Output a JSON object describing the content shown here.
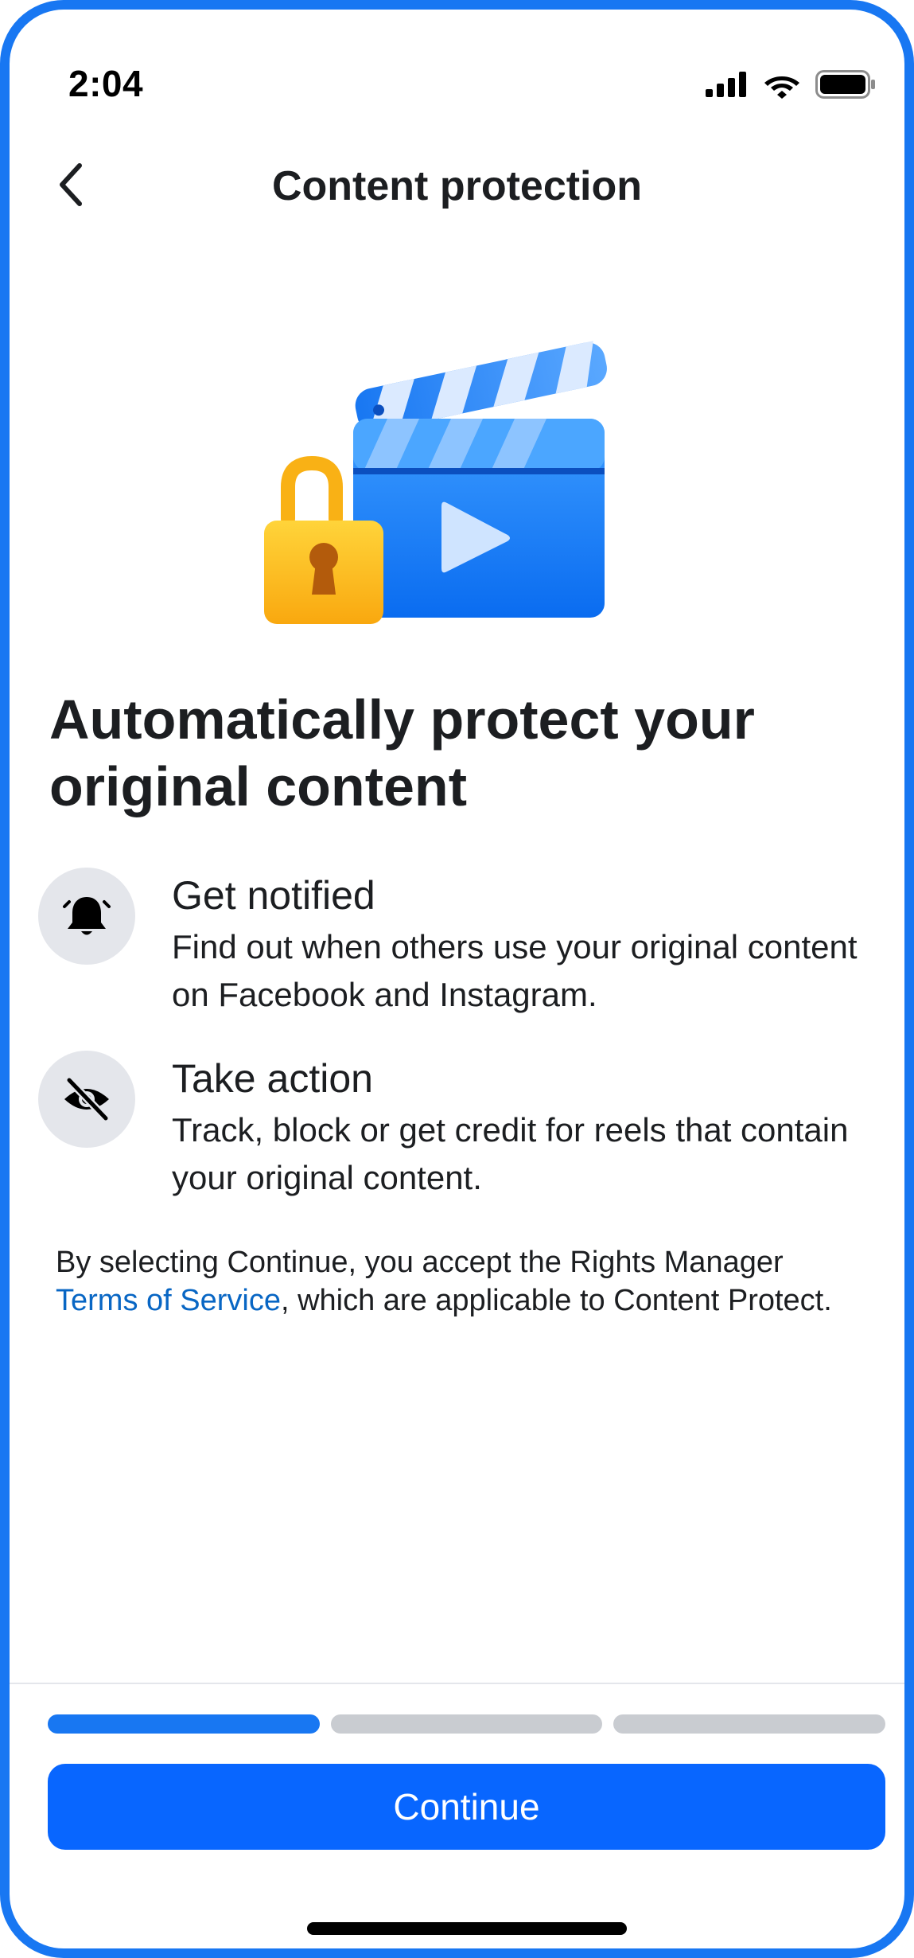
{
  "status_bar": {
    "time": "2:04",
    "icons": [
      "signal-icon",
      "wifi-icon",
      "battery-icon"
    ]
  },
  "header": {
    "back_icon": "chevron-left-icon",
    "title": "Content protection"
  },
  "hero": {
    "illustration": "clapperboard-with-padlock"
  },
  "headline": "Automatically protect your original content",
  "features": [
    {
      "icon": "bell-icon",
      "title": "Get notified",
      "description": "Find out when others use your original content on Facebook and Instagram."
    },
    {
      "icon": "eye-slash-icon",
      "title": "Take action",
      "description": "Track, block or get credit for reels that contain your original content."
    }
  ],
  "legal": {
    "prefix": "By selecting Continue, you accept the Rights Manager ",
    "link": "Terms of Service",
    "suffix": ", which are applicable to Content Protect."
  },
  "progress": {
    "current_step": 1,
    "total_steps": 3
  },
  "footer": {
    "continue_label": "Continue"
  },
  "colors": {
    "accent": "#1877f2",
    "button": "#0866ff",
    "link": "#0866c4",
    "icon_bg": "#e4e6eb",
    "inactive_progress": "#c9ccd1"
  }
}
